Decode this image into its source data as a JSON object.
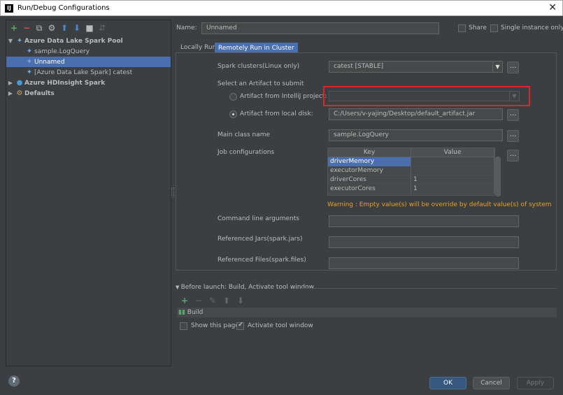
{
  "window": {
    "title": "Run/Debug Configurations",
    "app_icon_text": "IJ",
    "close_glyph": "✕"
  },
  "toolbar": {
    "add": "+",
    "remove": "−",
    "copy": "⧉",
    "edit_defaults": "⚙",
    "move_up": "⬆",
    "move_down": "⬇",
    "folder": "■",
    "sort": "⇵"
  },
  "tree": {
    "root": "Azure Data Lake Spark Pool",
    "children": [
      "sample.LogQuery",
      "Unnamed",
      "[Azure Data Lake Spark] catest"
    ],
    "hdinsight": "Azure HDInsight Spark",
    "defaults": "Defaults"
  },
  "form": {
    "name_label": "Name:",
    "name_value": "Unnamed",
    "share_label": "Share",
    "single_instance_label": "Single instance only"
  },
  "tabs": [
    "Locally Run",
    "Remotely Run in Cluster"
  ],
  "remote": {
    "spark_clusters_label": "Spark clusters(Linux only)",
    "spark_clusters_value": "catest [STABLE]",
    "select_artifact_label": "Select an Artifact to submit",
    "artifact_intellij_label": "Artifact from IntelliJ project:",
    "artifact_intellij_value": "",
    "artifact_disk_label": "Artifact from local disk:",
    "artifact_disk_value": "C:/Users/v-yajing/Desktop/default_artifact.jar",
    "main_class_label": "Main class name",
    "main_class_value": "sample.LogQuery",
    "job_config_label": "Job configurations",
    "job_table": {
      "headers": [
        "Key",
        "Value"
      ],
      "rows": [
        {
          "key": "driverMemory",
          "value": ""
        },
        {
          "key": "executorMemory",
          "value": ""
        },
        {
          "key": "driverCores",
          "value": "1"
        },
        {
          "key": "executorCores",
          "value": "1"
        }
      ]
    },
    "warning": "Warning : Empty value(s) will be override by default value(s) of system",
    "cmd_args_label": "Command line arguments",
    "cmd_args_value": "",
    "ref_jars_label": "Referenced Jars(spark.jars)",
    "ref_jars_value": "",
    "ref_files_label": "Referenced Files(spark.files)",
    "ref_files_value": "",
    "ellipsis": "...",
    "dropdown_glyph": "▼"
  },
  "before_launch": {
    "header": "Before launch: Build, Activate tool window",
    "add": "+",
    "remove": "−",
    "edit": "✎",
    "up": "⬆",
    "down": "⬇",
    "item": "Build",
    "show_page_label": "Show this page",
    "activate_label": "Activate tool window"
  },
  "buttons": {
    "help": "?",
    "ok": "OK",
    "cancel": "Cancel",
    "apply": "Apply"
  }
}
